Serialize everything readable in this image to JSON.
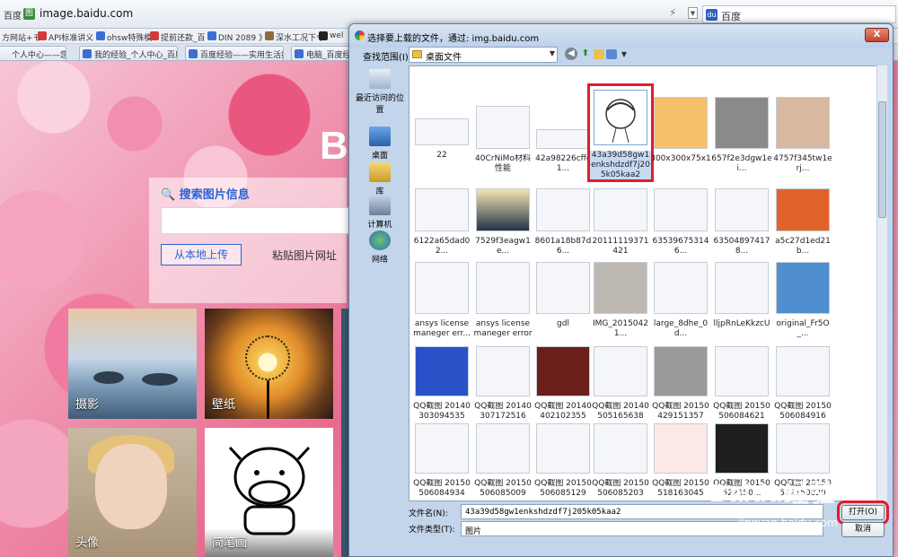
{
  "browser": {
    "site_label": "百度",
    "url": "image.baidu.com",
    "search_placeholder": "百度",
    "bookmarks": [
      "方网站+モ",
      "API标准讲义",
      "ohsw特殊模",
      "提前还款_百",
      "DIN 2089 》",
      "深水工况下令",
      "wel"
    ],
    "tabs": [
      "个人中心——您在百",
      "我的经验_个人中心_百度",
      "百度经验——实用生活指",
      "电脑_百度经"
    ]
  },
  "page": {
    "logo_partial": "B",
    "search_title": "搜索图片信息",
    "upload_button": "从本地上传",
    "paste_text": "粘贴图片网址",
    "tiles": [
      "摄影",
      "壁纸",
      "头像",
      "简笔画"
    ]
  },
  "dialog": {
    "title": "选择要上载的文件，通过: img.baidu.com",
    "close": "X",
    "lookin_label": "查找范围(I):",
    "lookin_value": "桌面文件",
    "places": [
      "最近访问的位置",
      "桌面",
      "库",
      "计算机",
      "网络"
    ],
    "files": [
      "22",
      "40CrNiMo材料性能",
      "42a98226cffc1...",
      "43a39d58gw1enkshdzdf7j205k05kaa2",
      "300x300x75x1",
      "657f2e3dgw1ei...",
      "4757f345tw1erj...",
      "6122a65dad02...",
      "7529f3eagw1e...",
      "8601a18b87d6...",
      "20111119371421",
      "635396753146...",
      "635048974178...",
      "a5c27d1ed21b...",
      "ansys license maneger err...",
      "ansys license maneger error",
      "gdl",
      "IMG_20150421...",
      "large_8dhe_0d...",
      "lljpRnLeKkzcU",
      "original_Fr5O_...",
      "QQ截图 20140303094535",
      "QQ截图 20140307172516",
      "QQ截图 20140402102355",
      "QQ截图 20140505165638",
      "QQ截图 20150429151357",
      "QQ截图 20150506084621",
      "QQ截图 20150506084916",
      "QQ截图 20150506084934",
      "QQ截图 20150506085009",
      "QQ截图 20150506085129",
      "QQ截图 20150506085203",
      "QQ截图 20150518163045",
      "QQ截图 20150522150...",
      "QQ截图 20150522150820"
    ],
    "selected_index": 3,
    "filename_label": "文件名(N):",
    "filename_value": "43a39d58gw1enkshdzdf7j205k05kaa2",
    "filetype_label": "文件类型(T):",
    "filetype_value": "图片",
    "open_button": "打开(O)",
    "cancel_button": "取消"
  },
  "watermark": {
    "brand": "Baidu经验",
    "url": "jingyan.baidu.com"
  },
  "colors": {
    "highlight_red": "#e21c2c",
    "baidu_blue": "#2b63d3"
  }
}
